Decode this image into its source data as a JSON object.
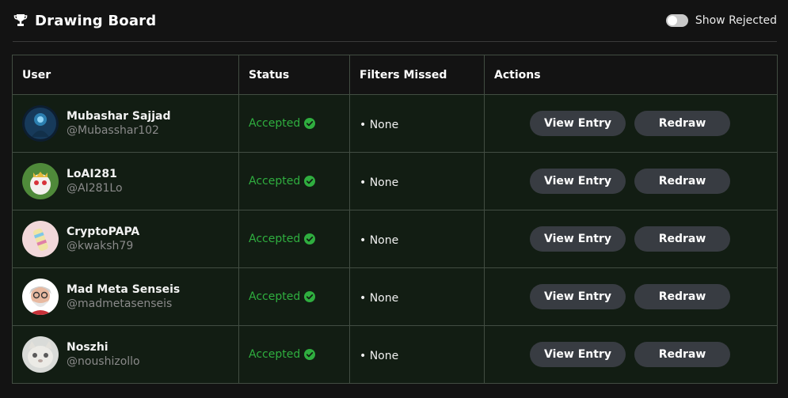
{
  "header": {
    "title": "Drawing Board",
    "title_icon": "trophy-icon",
    "toggle_label": "Show Rejected",
    "toggle_on": false
  },
  "table": {
    "columns": [
      "User",
      "Status",
      "Filters Missed",
      "Actions"
    ],
    "rows": [
      {
        "name": "Mubashar Sajjad",
        "handle": "@Mubasshar102",
        "status": "Accepted",
        "filters": "• None",
        "view_label": "View Entry",
        "redraw_label": "Redraw"
      },
      {
        "name": "LoAI281",
        "handle": "@AI281Lo",
        "status": "Accepted",
        "filters": "• None",
        "view_label": "View Entry",
        "redraw_label": "Redraw"
      },
      {
        "name": "CryptoPAPA",
        "handle": "@kwaksh79",
        "status": "Accepted",
        "filters": "• None",
        "view_label": "View Entry",
        "redraw_label": "Redraw"
      },
      {
        "name": "Mad Meta Senseis",
        "handle": "@madmetasenseis",
        "status": "Accepted",
        "filters": "• None",
        "view_label": "View Entry",
        "redraw_label": "Redraw"
      },
      {
        "name": "Noszhi",
        "handle": "@noushizollo",
        "status": "Accepted",
        "filters": "• None",
        "view_label": "View Entry",
        "redraw_label": "Redraw"
      }
    ]
  },
  "colors": {
    "background": "#131313",
    "row_background": "#121d13",
    "accepted": "#2fae3f",
    "button": "#383c42"
  }
}
